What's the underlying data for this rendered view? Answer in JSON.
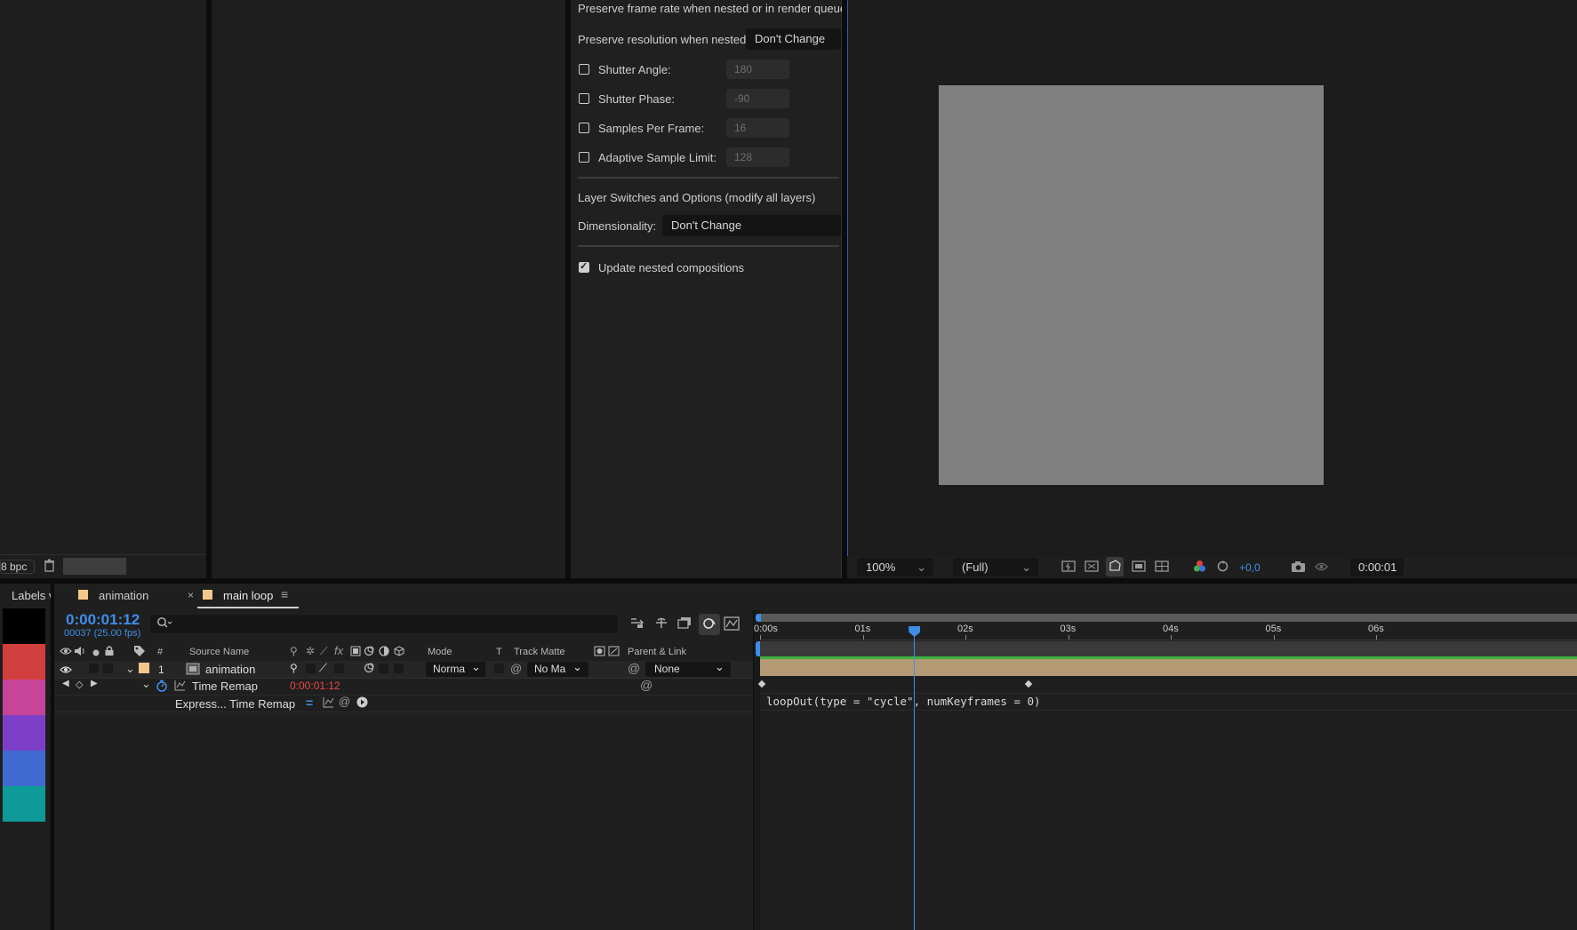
{
  "left_panel": {
    "bpc_label": "8 bpc",
    "trash_icon": "trash-icon"
  },
  "comp_settings": {
    "preserve_frame_rate": "Preserve frame rate when nested or in render queue:",
    "preserve_resolution_label": "Preserve resolution when nested:",
    "preserve_resolution_value": "Don't Change",
    "options": [
      {
        "label": "Shutter Angle:",
        "value": "180",
        "checked": false
      },
      {
        "label": "Shutter Phase:",
        "value": "-90",
        "checked": false
      },
      {
        "label": "Samples Per Frame:",
        "value": "16",
        "checked": false
      },
      {
        "label": "Adaptive Sample Limit:",
        "value": "128",
        "checked": false
      }
    ],
    "layer_switches_header": "Layer Switches and Options (modify all layers)",
    "dimensionality_label": "Dimensionality:",
    "dimensionality_value": "Don't Change",
    "update_nested_label": "Update nested compositions",
    "update_nested_checked": true
  },
  "viewer": {
    "canvas_color": "#808080",
    "zoom": "100%",
    "resolution": "(Full)",
    "exposure": "+0,0",
    "timecode": "0:00:01"
  },
  "labels_panel": {
    "title": "Labels v",
    "colors": [
      "#000000",
      "#d13f3f",
      "#c8449a",
      "#7d3fc8",
      "#3f6ad1",
      "#0f9a9a"
    ]
  },
  "timeline": {
    "tabs": [
      {
        "label": "animation",
        "color": "#f2c88a",
        "active": false
      },
      {
        "label": "main loop",
        "color": "#f2c88a",
        "active": true
      }
    ],
    "current_time": "0:00:01:12",
    "frame_info": "00037 (25.00 fps)",
    "search_placeholder": "",
    "columns": {
      "number": "#",
      "source_name": "Source Name",
      "mode": "Mode",
      "t": "T",
      "track_matte": "Track Matte",
      "parent_link": "Parent & Link"
    },
    "layer": {
      "index": "1",
      "name": "animation",
      "label_color": "#f2c88a",
      "mode": "Norma",
      "track_matte": "No Ma",
      "parent": "None"
    },
    "time_remap": {
      "label": "Time Remap",
      "value": "0:00:01:12"
    },
    "expression": {
      "label": "Express... Time Remap",
      "code": "loopOut(type = \"cycle\", numKeyframes = 0)"
    },
    "ruler_ticks": [
      "0:00s",
      "01s",
      "02s",
      "03s",
      "04s",
      "05s",
      "06s"
    ],
    "playhead_seconds": 1.5,
    "layer_bar_color": "#b39a73",
    "keyframe_seconds": [
      0,
      2.6
    ]
  }
}
